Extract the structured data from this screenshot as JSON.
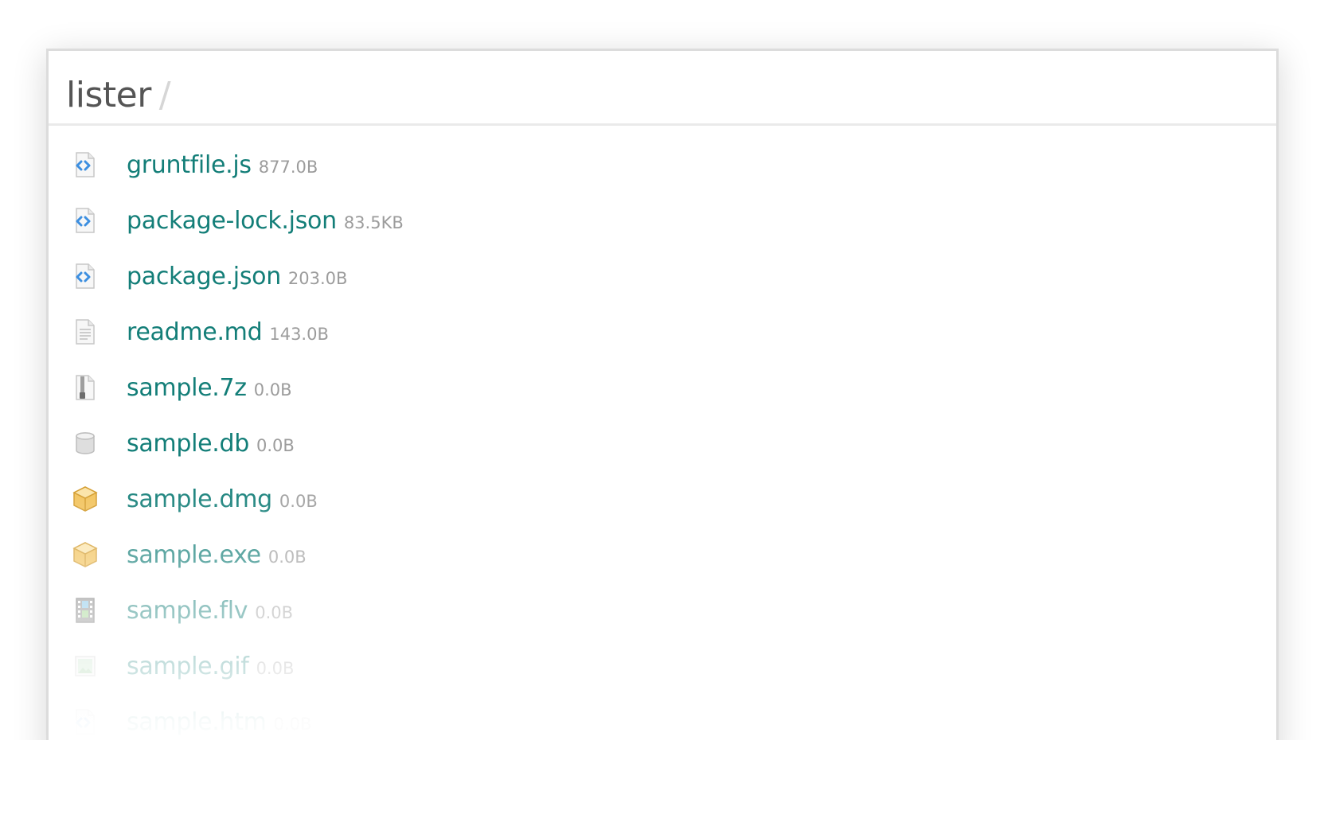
{
  "header": {
    "title": "lister",
    "separator": "/"
  },
  "files": [
    {
      "name": "gruntfile.js",
      "size": "877.0B",
      "icon": "code-file-icon"
    },
    {
      "name": "package-lock.json",
      "size": "83.5KB",
      "icon": "code-file-icon"
    },
    {
      "name": "package.json",
      "size": "203.0B",
      "icon": "code-file-icon"
    },
    {
      "name": "readme.md",
      "size": "143.0B",
      "icon": "text-file-icon"
    },
    {
      "name": "sample.7z",
      "size": "0.0B",
      "icon": "archive-file-icon"
    },
    {
      "name": "sample.db",
      "size": "0.0B",
      "icon": "database-file-icon"
    },
    {
      "name": "sample.dmg",
      "size": "0.0B",
      "icon": "package-box-icon"
    },
    {
      "name": "sample.exe",
      "size": "0.0B",
      "icon": "package-box-icon"
    },
    {
      "name": "sample.flv",
      "size": "0.0B",
      "icon": "film-file-icon"
    },
    {
      "name": "sample.gif",
      "size": "0.0B",
      "icon": "image-file-icon"
    },
    {
      "name": "sample.htm",
      "size": "0.0B",
      "icon": "code-file-icon"
    }
  ],
  "colors": {
    "link": "#137e78",
    "size": "#9c9c9c",
    "title": "#555555",
    "separator": "#d6d6d6",
    "code_icon_accent": "#3d8fe0",
    "box_icon": "#f2c25a"
  }
}
